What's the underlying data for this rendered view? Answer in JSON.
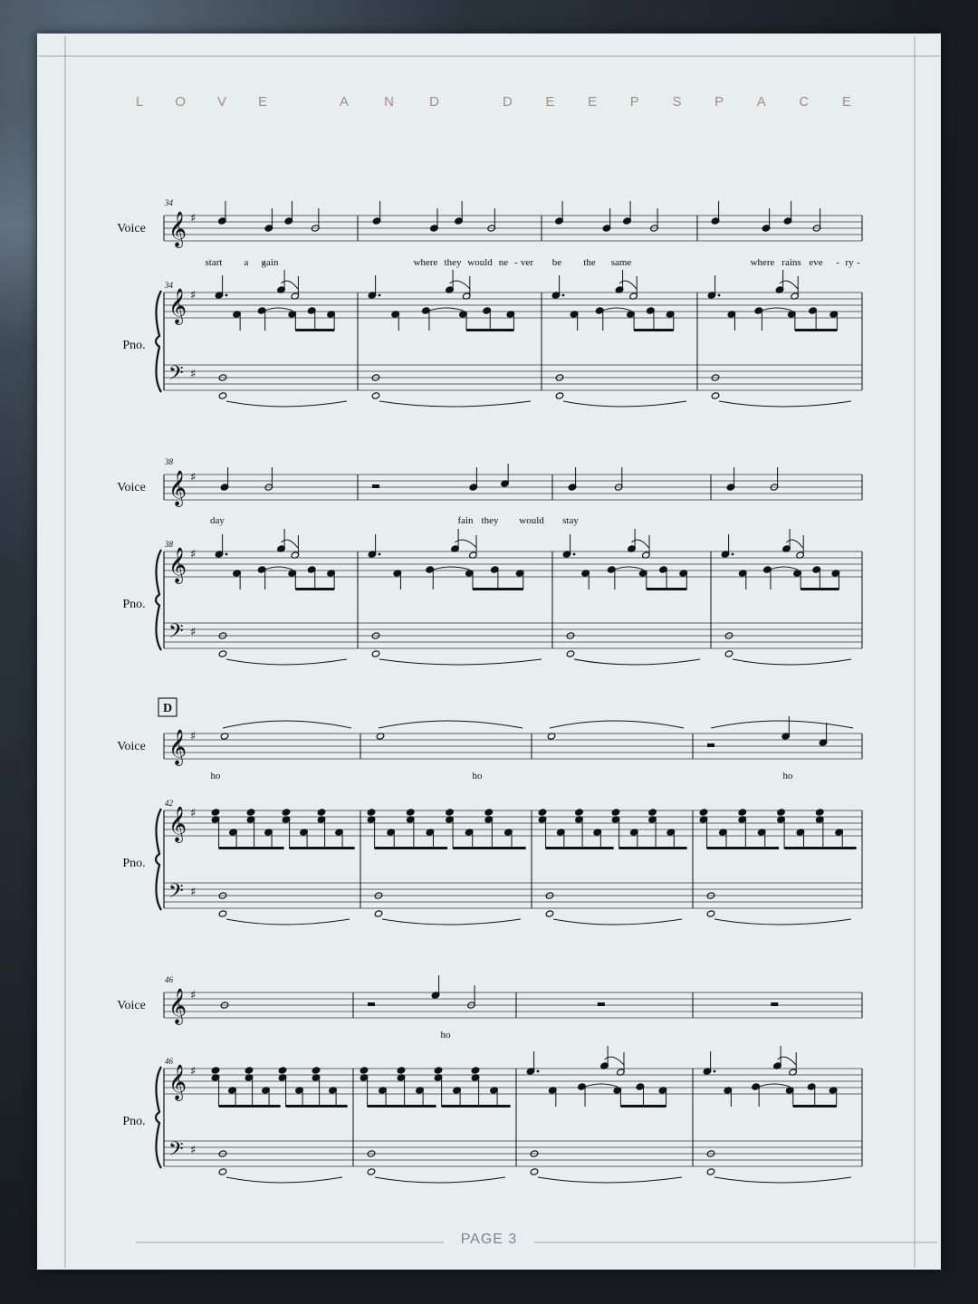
{
  "header": {
    "words": [
      "LOVE",
      "AND",
      "DEEPSPACE"
    ]
  },
  "instruments": {
    "voice": "Voice",
    "piano": "Pno."
  },
  "rehearsal_mark": "D",
  "systems": [
    {
      "measure_start": "34",
      "lyrics": [
        "start",
        "a",
        "-",
        "gain",
        "where",
        "they",
        "would",
        "ne",
        "-",
        "ver",
        "be",
        "the",
        "same",
        "where",
        "rains",
        "eve",
        "-",
        "ry",
        "-"
      ]
    },
    {
      "measure_start": "38",
      "lyrics": [
        "day",
        "fain",
        "they",
        "would",
        "stay"
      ]
    },
    {
      "measure_start": "42",
      "lyrics": [
        "ho",
        "ho",
        "ho"
      ]
    },
    {
      "measure_start": "46",
      "lyrics": [
        "ho"
      ]
    }
  ],
  "footer": {
    "page_label": "PAGE 3"
  }
}
